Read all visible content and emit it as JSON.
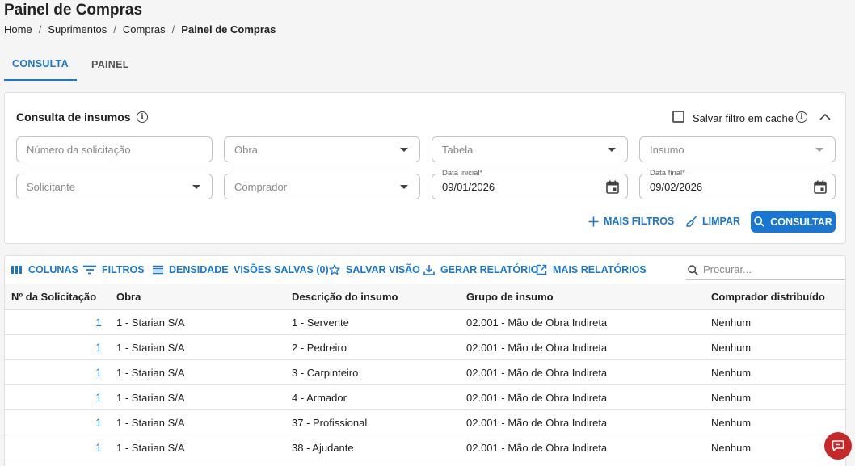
{
  "page": {
    "title": "Painel de Compras",
    "breadcrumb": [
      "Home",
      "Suprimentos",
      "Compras",
      "Painel de Compras"
    ],
    "separator": "/"
  },
  "tabs": [
    {
      "label": "CONSULTA",
      "active": true
    },
    {
      "label": "PAINEL",
      "active": false
    }
  ],
  "filters": {
    "title": "Consulta de insumos",
    "cache_label": "Salvar filtro em cache",
    "cache_checked": false,
    "fields": {
      "numero": {
        "placeholder": "Número da solicitação"
      },
      "obra": {
        "placeholder": "Obra"
      },
      "tabela": {
        "placeholder": "Tabela"
      },
      "insumo": {
        "placeholder": "Insumo"
      },
      "solicitante": {
        "placeholder": "Solicitante"
      },
      "comprador": {
        "placeholder": "Comprador"
      },
      "data_inicial": {
        "label": "Data inicial*",
        "value": "09/01/2026"
      },
      "data_final": {
        "label": "Data final*",
        "value": "09/02/2026"
      }
    },
    "actions": {
      "mais_filtros": "MAIS FILTROS",
      "limpar": "LIMPAR",
      "consultar": "CONSULTAR"
    }
  },
  "toolbar": {
    "colunas": "COLUNAS",
    "filtros": "FILTROS",
    "densidade": "DENSIDADE",
    "visoes_salvas": "VISÕES SALVAS (0)",
    "salvar_visao": "SALVAR VISÃO",
    "gerar_relatorio": "GERAR RELATÓRIO",
    "mais_relatorios": "MAIS RELATÓRIOS",
    "search_placeholder": "Procurar..."
  },
  "table": {
    "columns": [
      "Nº da Solicitação",
      "Obra",
      "Descrição do insumo",
      "Grupo de insumo",
      "Comprador distribuído"
    ],
    "rows": [
      {
        "num": "1",
        "obra": "1 - Starian S/A",
        "descricao": "1 - Servente",
        "grupo": "02.001 - Mão de Obra Indireta",
        "comprador": "Nenhum"
      },
      {
        "num": "1",
        "obra": "1 - Starian S/A",
        "descricao": "2 - Pedreiro",
        "grupo": "02.001 - Mão de Obra Indireta",
        "comprador": "Nenhum"
      },
      {
        "num": "1",
        "obra": "1 - Starian S/A",
        "descricao": "3 - Carpinteiro",
        "grupo": "02.001 - Mão de Obra Indireta",
        "comprador": "Nenhum"
      },
      {
        "num": "1",
        "obra": "1 - Starian S/A",
        "descricao": "4 - Armador",
        "grupo": "02.001 - Mão de Obra Indireta",
        "comprador": "Nenhum"
      },
      {
        "num": "1",
        "obra": "1 - Starian S/A",
        "descricao": "37 - Profissional",
        "grupo": "02.001 - Mão de Obra Indireta",
        "comprador": "Nenhum"
      },
      {
        "num": "1",
        "obra": "1 - Starian S/A",
        "descricao": "38 - Ajudante",
        "grupo": "02.001 - Mão de Obra Indireta",
        "comprador": "Nenhum"
      }
    ]
  },
  "colors": {
    "accent": "#1976d2",
    "fab": "#c62828"
  }
}
